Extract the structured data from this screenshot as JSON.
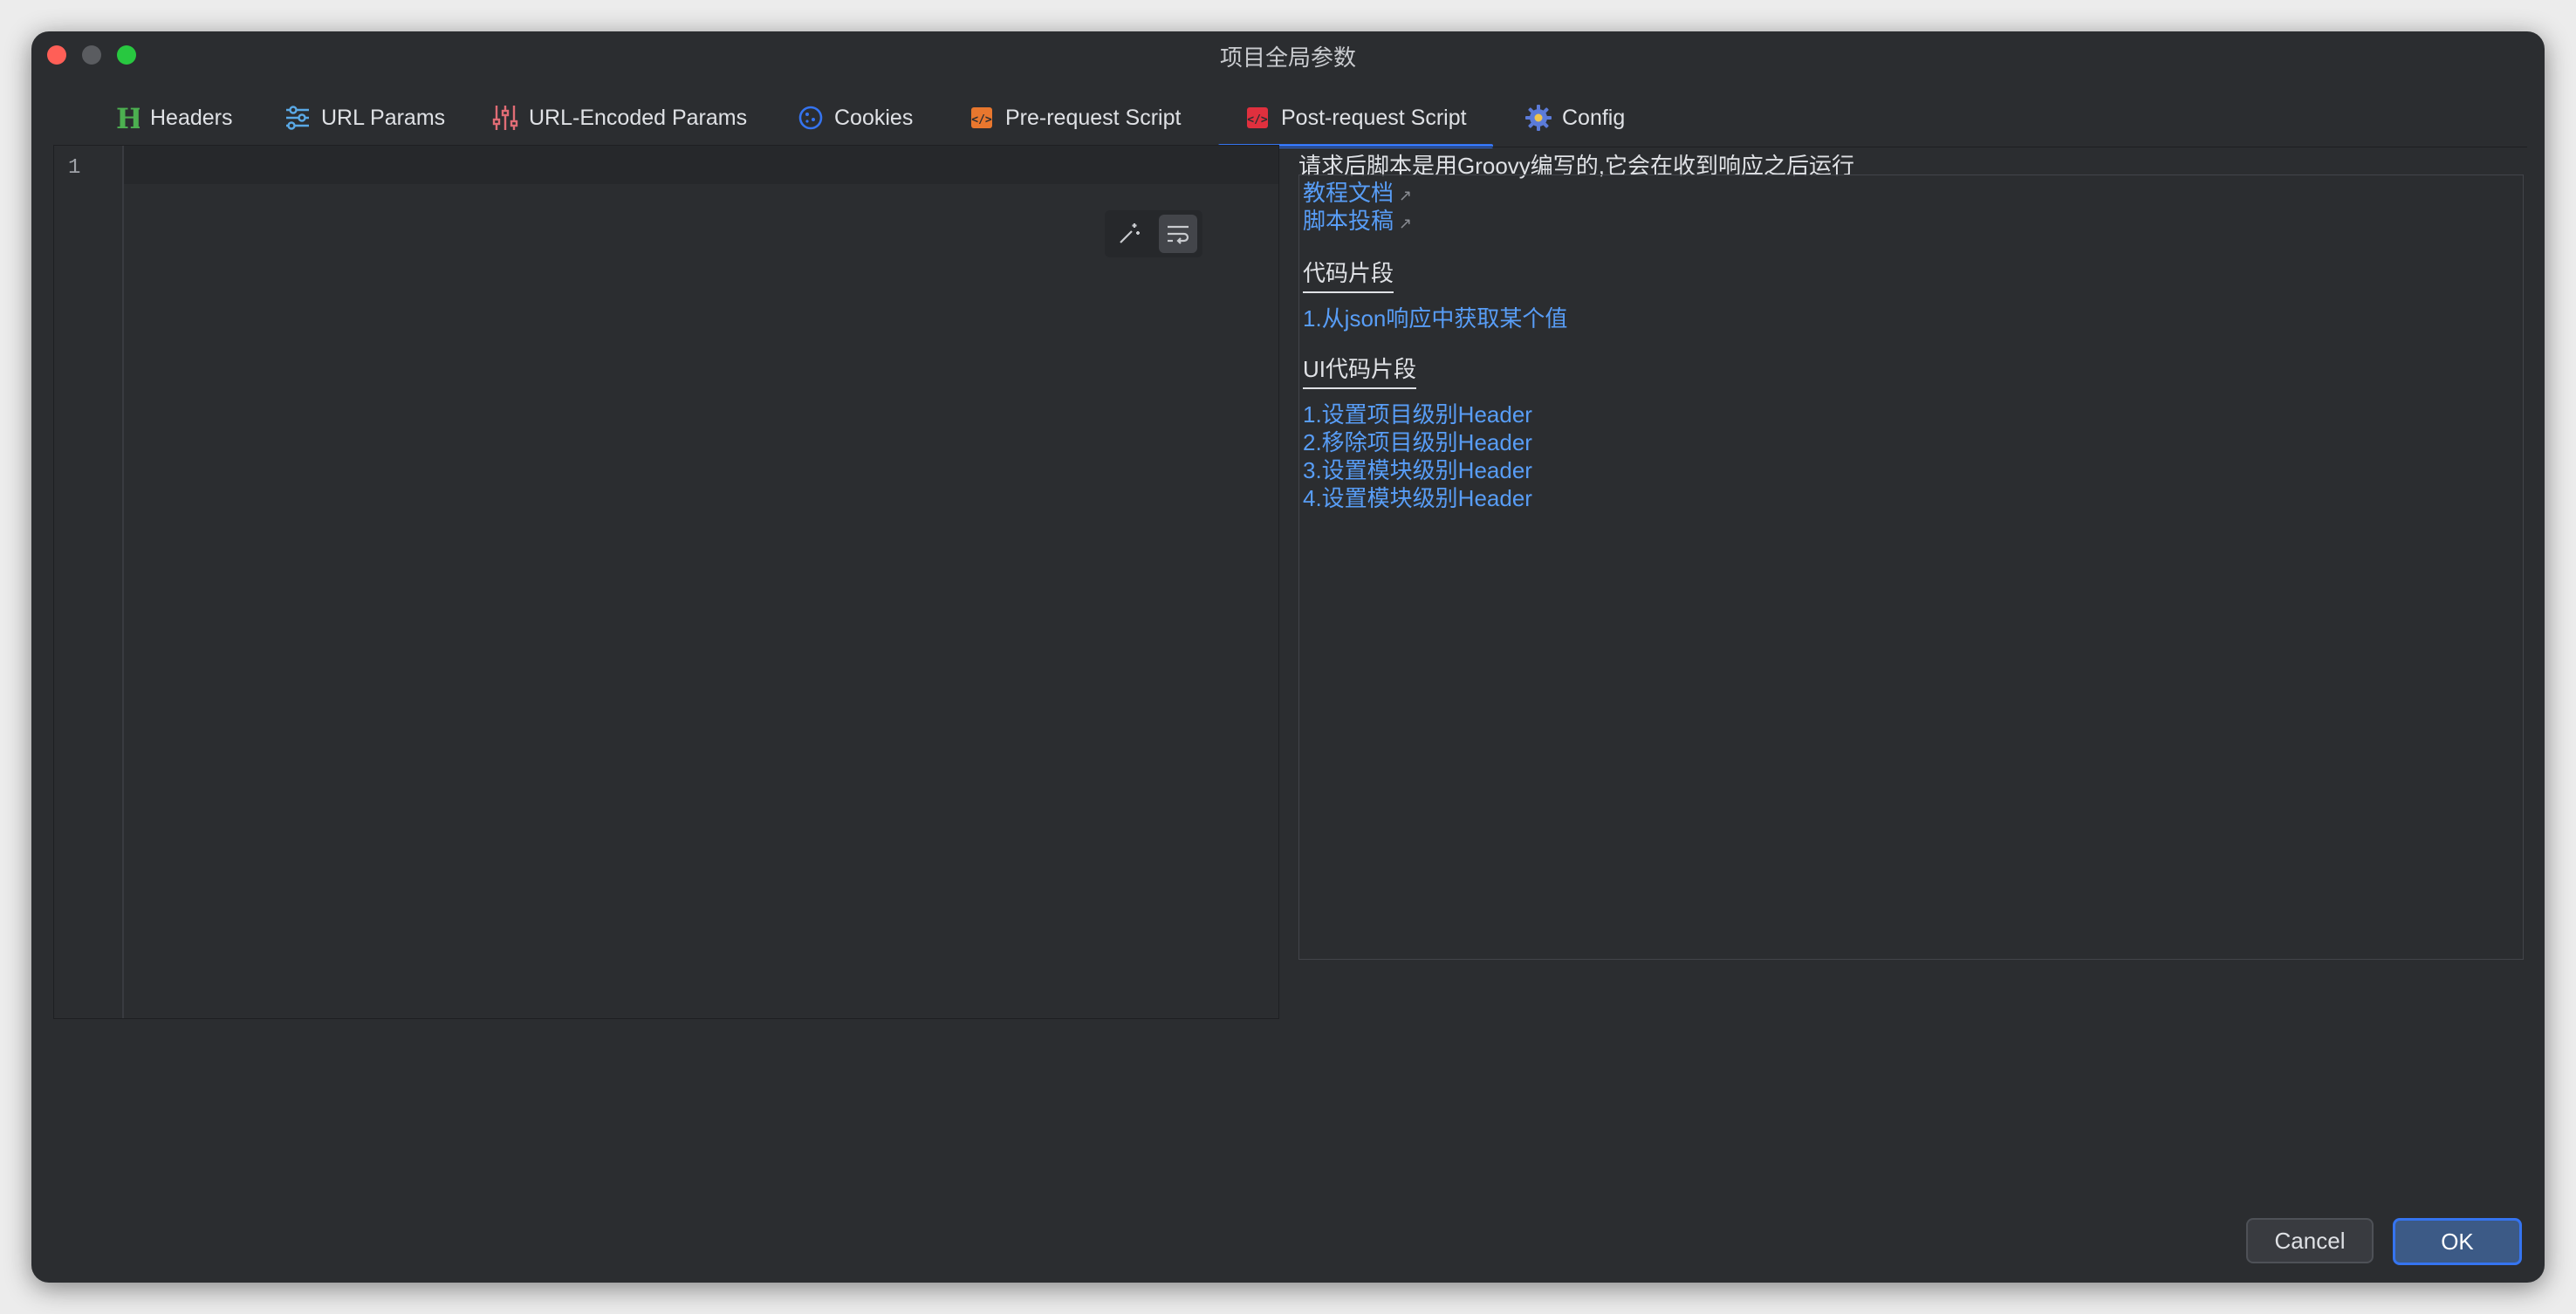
{
  "window": {
    "title": "项目全局参数"
  },
  "tabs": [
    {
      "label": "Headers",
      "icon": "headers-h-icon",
      "color": "#4caf50"
    },
    {
      "label": "URL Params",
      "icon": "sliders-icon",
      "color": "#5aa9e6"
    },
    {
      "label": "URL-Encoded Params",
      "icon": "equalizer-icon",
      "color": "#e06c75"
    },
    {
      "label": "Cookies",
      "icon": "cookie-icon",
      "color": "#3574f0"
    },
    {
      "label": "Pre-request Script",
      "icon": "code-file-icon",
      "color": "#e8772e"
    },
    {
      "label": "Post-request Script",
      "icon": "code-file-icon",
      "color": "#e0303e",
      "active": true
    },
    {
      "label": "Config",
      "icon": "gear-icon",
      "color": "#5b7bd9"
    }
  ],
  "editor": {
    "line_number": "1",
    "tools": [
      "magic-wand-icon",
      "soft-wrap-icon"
    ]
  },
  "help": {
    "intro": "请求后脚本是用Groovy编写的,它会在收到响应之后运行",
    "links": [
      "教程文档",
      "脚本投稿"
    ],
    "snippet_title": "代码片段",
    "snippets": [
      "1.从json响应中获取某个值"
    ],
    "ui_snippet_title": "UI代码片段",
    "ui_snippets": [
      "1.设置项目级别Header",
      "2.移除项目级别Header",
      "3.设置模块级别Header",
      "4.设置模块级别Header"
    ]
  },
  "buttons": {
    "cancel": "Cancel",
    "ok": "OK"
  }
}
